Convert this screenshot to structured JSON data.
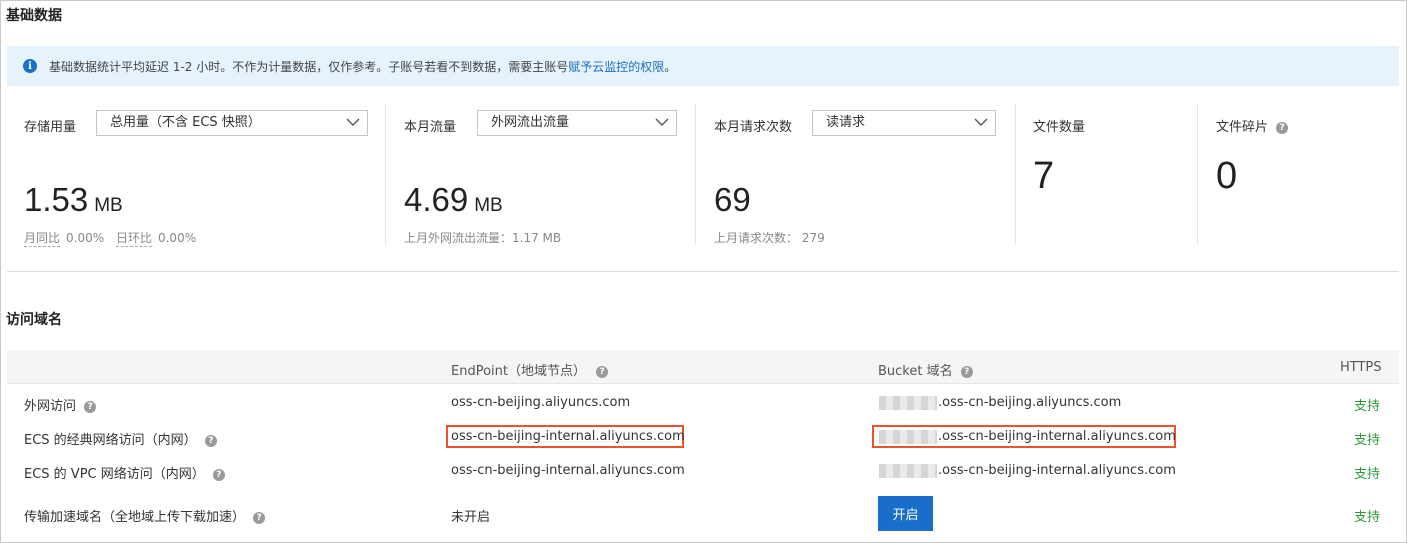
{
  "basic": {
    "title": "基础数据",
    "notice_text": "基础数据统计平均延迟 1-2 小时。不作为计量数据，仅作参考。子账号若看不到数据，需要主账号",
    "notice_link": "赋予云监控的权限",
    "notice_end": "。",
    "storage": {
      "label": "存储用量",
      "select_value": "总用量（不含 ECS 快照）",
      "value": "1.53",
      "unit": "MB",
      "yoy_label": "月同比",
      "yoy_value": "0.00%",
      "mom_label": "日环比",
      "mom_value": "0.00%"
    },
    "traffic": {
      "label": "本月流量",
      "select_value": "外网流出流量",
      "value": "4.69",
      "unit": "MB",
      "last_month": "上月外网流出流量：1.17 MB"
    },
    "requests": {
      "label": "本月请求次数",
      "select_value": "读请求",
      "value": "69",
      "last_month": "上月请求次数： 279"
    },
    "files": {
      "label": "文件数量",
      "value": "7"
    },
    "fragments": {
      "label": "文件碎片",
      "value": "0"
    }
  },
  "domains": {
    "title": "访问域名",
    "headers": {
      "endpoint": "EndPoint（地域节点）",
      "bucket": "Bucket 域名",
      "https": "HTTPS"
    },
    "rows": [
      {
        "label": "外网访问",
        "endpoint": "oss-cn-beijing.aliyuncs.com",
        "bucket": ".oss-cn-beijing.aliyuncs.com",
        "https": "支持"
      },
      {
        "label": "ECS 的经典网络访问（内网）",
        "endpoint": "oss-cn-beijing-internal.aliyuncs.com",
        "bucket": ".oss-cn-beijing-internal.aliyuncs.com",
        "https": "支持"
      },
      {
        "label": "ECS 的 VPC 网络访问（内网）",
        "endpoint": "oss-cn-beijing-internal.aliyuncs.com",
        "bucket": ".oss-cn-beijing-internal.aliyuncs.com",
        "https": "支持"
      },
      {
        "label": "传输加速域名（全地域上传下载加速）",
        "endpoint": "未开启",
        "button": "开启",
        "https": "支持"
      }
    ]
  },
  "colors": {
    "accent": "#1a6ec9",
    "support": "#2c9b3a",
    "highlight": "#e8552d",
    "notice_bg": "#e6f3fd"
  },
  "icons": {
    "info": "info-icon",
    "help": "question-circle-icon",
    "dropdown": "chevron-down-icon"
  }
}
